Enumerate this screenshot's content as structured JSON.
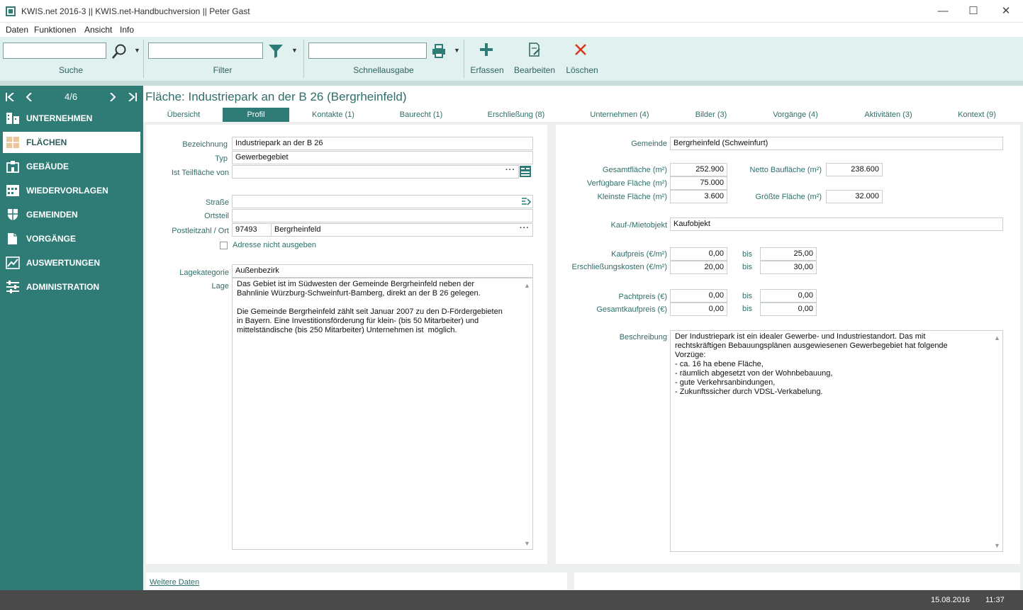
{
  "window": {
    "title": "KWIS.net 2016-3 || KWIS.net-Handbuchversion || Peter Gast",
    "minimize": "—",
    "maximize": "☐",
    "close": "✕"
  },
  "menu": [
    "Daten",
    "Funktionen",
    "Ansicht",
    "Info"
  ],
  "toolbar": {
    "search_label": "Suche",
    "filter_label": "Filter",
    "quickprint_label": "Schnellausgabe",
    "create_label": "Erfassen",
    "edit_label": "Bearbeiten",
    "delete_label": "Löschen",
    "search_value": "",
    "filter_value": "",
    "quickprint_value": ""
  },
  "record_nav": {
    "counter": "4/6"
  },
  "sidebar": {
    "items": [
      {
        "label": "UNTERNEHMEN",
        "icon": "buildings-icon"
      },
      {
        "label": "FLÄCHEN",
        "icon": "area-icon"
      },
      {
        "label": "GEBÄUDE",
        "icon": "building-icon"
      },
      {
        "label": "WIEDERVORLAGEN",
        "icon": "calendar-icon"
      },
      {
        "label": "GEMEINDEN",
        "icon": "shield-icon"
      },
      {
        "label": "VORGÄNGE",
        "icon": "document-icon"
      },
      {
        "label": "AUSWERTUNGEN",
        "icon": "chart-icon"
      },
      {
        "label": "ADMINISTRATION",
        "icon": "sliders-icon"
      }
    ],
    "active": "FLÄCHEN"
  },
  "page": {
    "title": "Fläche: Industriepark an der B 26 (Bergrheinfeld)"
  },
  "tabs": [
    "Übersicht",
    "Profil",
    "Kontakte (1)",
    "Baurecht (1)",
    "Erschließung (8)",
    "Unternehmen (4)",
    "Bilder (3)",
    "Vorgänge (4)",
    "Aktivitäten (3)",
    "Kontext (9)"
  ],
  "left_form": {
    "bezeichnung_label": "Bezeichnung",
    "bezeichnung": "Industriepark an der B 26",
    "typ_label": "Typ",
    "typ": "Gewerbegebiet",
    "teilflaeche_label": "Ist Teilfläche von",
    "teilflaeche": "",
    "strasse_label": "Straße",
    "strasse": "",
    "ortsteil_label": "Ortsteil",
    "ortsteil": "",
    "plz_label": "Postleitzahl / Ort",
    "plz": "97493",
    "ort": "Bergrheinfeld",
    "adresse_checkbox_label": "Adresse nicht ausgeben",
    "lagekategorie_label": "Lagekategorie",
    "lagekategorie": "Außenbezirk",
    "lage_label": "Lage",
    "lage": "Das Gebiet ist im Südwesten der Gemeinde Bergrheinfeld neben der\nBahnlinie Würzburg-Schweinfurt-Bamberg, direkt an der B 26 gelegen.\n\nDie Gemeinde Bergrheinfeld zählt seit Januar 2007 zu den D-Fördergebieten\nin Bayern. Eine Investitionsförderung für klein- (bis 50 Mitarbeiter) und\nmittelständische (bis 250 Mitarbeiter) Unternehmen ist  möglich."
  },
  "right_form": {
    "gemeinde_label": "Gemeinde",
    "gemeinde": "Bergrheinfeld (Schweinfurt)",
    "gesamtflaeche_label": "Gesamtfläche (m²)",
    "gesamtflaeche": "252.900",
    "netto_label": "Netto Baufläche (m²)",
    "netto": "238.600",
    "verfuegbar_label": "Verfügbare Fläche (m²)",
    "verfuegbar": "75.000",
    "kleinste_label": "Kleinste Fläche (m²)",
    "kleinste": "3.600",
    "groesste_label": "Größte Fläche (m²)",
    "groesste": "32.000",
    "kaufmiet_label": "Kauf-/Mietobjekt",
    "kaufmiet": "Kaufobjekt",
    "kaufpreis_label": "Kaufpreis (€/m²)",
    "kaufpreis_von": "0,00",
    "kaufpreis_bis": "25,00",
    "erschliessung_label": "Erschließungskosten (€/m²)",
    "erschliessung_von": "20,00",
    "erschliessung_bis": "30,00",
    "pachtpreis_label": "Pachtpreis (€)",
    "pachtpreis_von": "0,00",
    "pachtpreis_bis": "0,00",
    "gesamtkauf_label": "Gesamtkaufpreis (€)",
    "gesamtkauf_von": "0,00",
    "gesamtkauf_bis": "0,00",
    "bis": "bis",
    "beschreibung_label": "Beschreibung",
    "beschreibung": "Der Industriepark ist ein idealer Gewerbe- und Industriestandort. Das mit\nrechtskräftigen Bebauungsplänen ausgewiesenen Gewerbegebiet hat folgende\nVorzüge:\n- ca. 16 ha ebene Fläche,\n- räumlich abgesetzt von der Wohnbebauung,\n- gute Verkehrsanbindungen,\n- Zukunftssicher durch VDSL-Verkabelung."
  },
  "footer": {
    "weitere_daten": "Weitere Daten"
  },
  "status": {
    "date": "15.08.2016",
    "time": "11:37"
  },
  "colors": {
    "teal": "#2f7c77",
    "toolbar_bg": "#e1f1ef",
    "delete_red": "#d9341e"
  }
}
